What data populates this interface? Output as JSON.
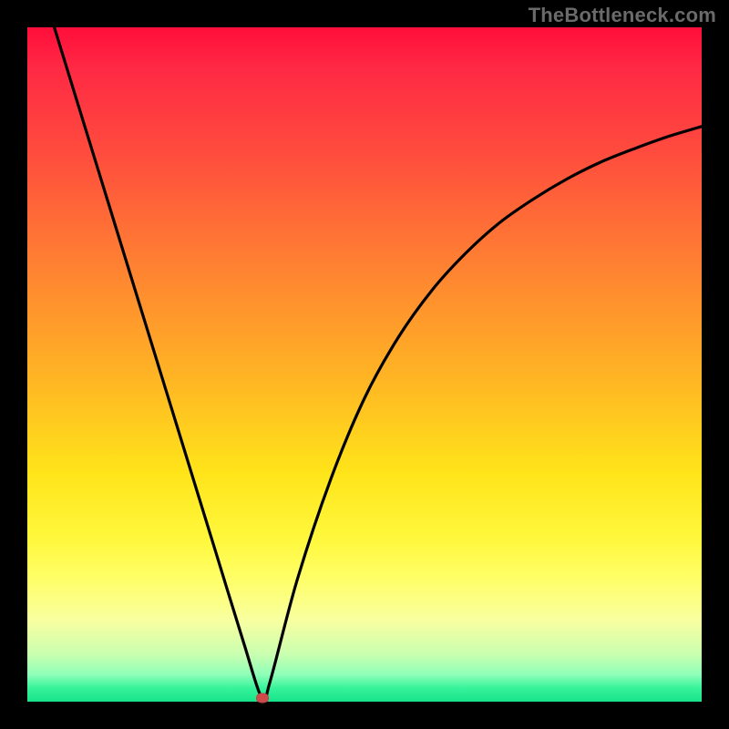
{
  "watermark": "TheBottleneck.com",
  "chart_data": {
    "type": "line",
    "title": "",
    "xlabel": "",
    "ylabel": "",
    "xlim": [
      0,
      100
    ],
    "ylim": [
      0,
      100
    ],
    "grid": false,
    "background_gradient": [
      "#ff0e3a",
      "#ff7d33",
      "#ffe41a",
      "#ffff6a",
      "#36f39a"
    ],
    "series": [
      {
        "name": "curve",
        "color": "#000000",
        "x": [
          4,
          8,
          12,
          16,
          20,
          24,
          28,
          32,
          34.8,
          36,
          40,
          45,
          50,
          55,
          60,
          65,
          70,
          75,
          80,
          85,
          90,
          95,
          100
        ],
        "y": [
          100,
          87,
          74,
          61,
          48,
          35,
          22,
          9,
          0.5,
          3,
          18,
          33,
          45,
          54,
          61,
          66.5,
          71,
          74.5,
          77.5,
          80,
          82,
          83.8,
          85.3
        ]
      }
    ],
    "marker": {
      "x": 34.8,
      "y": 0.5,
      "color": "#cf4a4a"
    }
  }
}
